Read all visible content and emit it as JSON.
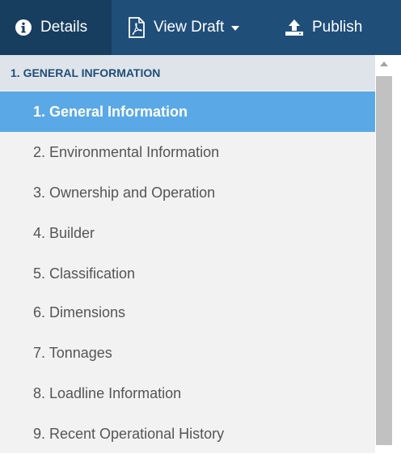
{
  "toolbar": {
    "details_label": "Details",
    "view_draft_label": "View Draft",
    "publish_label": "Publish",
    "colors": {
      "background": "#1f4e79",
      "active": "#173d5f",
      "text": "#ffffff"
    }
  },
  "sidebar": {
    "section_header": "1. GENERAL INFORMATION",
    "active_index": 0,
    "items": [
      {
        "label": "1. General Information"
      },
      {
        "label": "2. Environmental Information"
      },
      {
        "label": "3. Ownership and Operation"
      },
      {
        "label": "4. Builder"
      },
      {
        "label": "5. Classification"
      },
      {
        "label": "6. Dimensions"
      },
      {
        "label": "7. Tonnages"
      },
      {
        "label": "8. Loadline Information"
      },
      {
        "label": "9. Recent Operational History"
      }
    ],
    "colors": {
      "active_bg": "#5aa9e6",
      "header_text": "#1f4e79",
      "item_text": "#555555"
    }
  },
  "icons": {
    "details": "info-circle-icon",
    "view_draft": "pdf-file-icon",
    "publish": "upload-icon"
  }
}
